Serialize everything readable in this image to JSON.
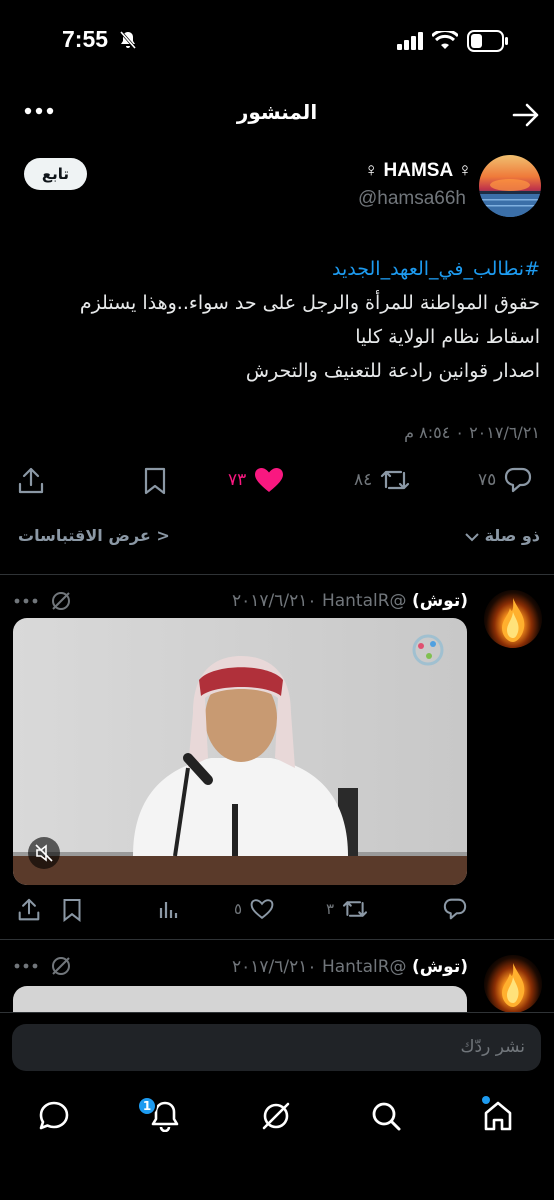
{
  "status_bar": {
    "time": "7:55"
  },
  "header": {
    "title": "المنشور"
  },
  "post": {
    "author_name": "HAMSA ♀︎",
    "author_name_prefix": "♀︎",
    "author_handle": "@hamsa66h",
    "follow_label": "تابع",
    "hashtag": "#نطالب_في_العهد_الجديد",
    "lines": [
      "حقوق المواطنة للمرأة والرجل على حد سواء..وهذا يستلزم",
      "اسقاط نظام الولاية كليا",
      "اصدار قوانين رادعة للتعنيف والتحرش"
    ],
    "timestamp": "٢٠١٧/٦/٢١ ٠ ٨:٥٤ م",
    "replies_count": "٧٥",
    "reposts_count": "٨٤",
    "likes_count": "٧٣",
    "quotes_link": "< عرض الاقتباسات",
    "sort_label": "ذو صلة"
  },
  "replies": [
    {
      "name": "(توش)",
      "handle_date": "@HantalR ٢٠١٧/٦/٢١٠",
      "likes_count": "٥",
      "reposts_count": "٣"
    },
    {
      "name": "(توش)",
      "handle_date": "@HantalR ٢٠١٧/٦/٢١٠"
    }
  ],
  "compose": {
    "placeholder": "نشر ردّك"
  },
  "tab_bar": {
    "notification_badge": "1"
  },
  "colors": {
    "accent": "#1d9bf0",
    "like": "#f91880",
    "muted": "#71767b"
  }
}
